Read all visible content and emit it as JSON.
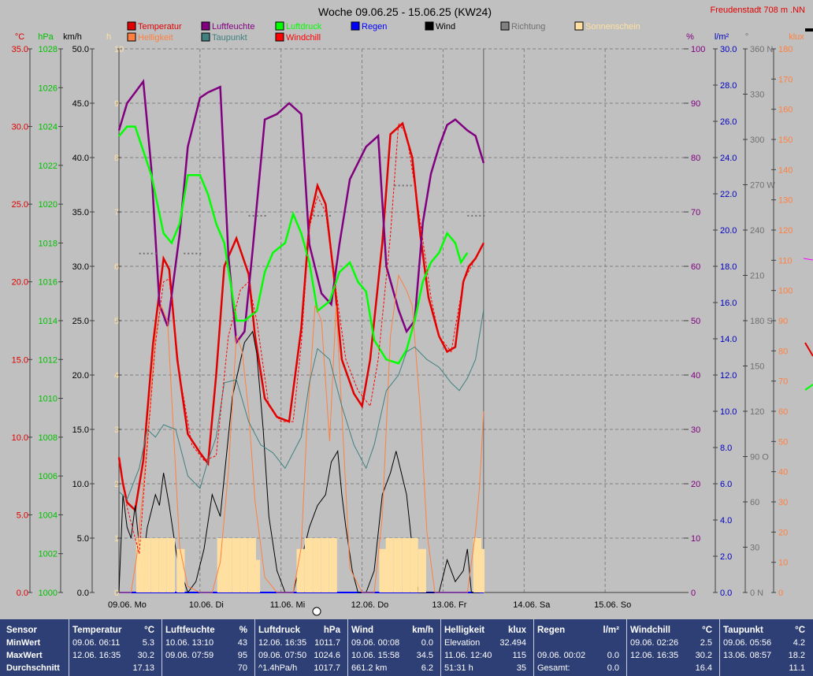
{
  "title": "Woche 09.06.25 - 15.06.25 (KW24)",
  "station": "Freudenstadt 708 m  .NN",
  "legend": [
    {
      "label": "Temperatur",
      "box": "#e00000",
      "text": "#e00000"
    },
    {
      "label": "Luftfeuchte",
      "box": "#800080",
      "text": "#800080"
    },
    {
      "label": "Luftdruck",
      "box": "#00ff00",
      "text": "#00ff00"
    },
    {
      "label": "Regen",
      "box": "#0000ff",
      "text": "#0000ff"
    },
    {
      "label": "Wind",
      "box": "#000000",
      "text": "#000000"
    },
    {
      "label": "Richtung",
      "box": "#808080",
      "text": "#707070"
    },
    {
      "label": "Sonnenschein",
      "box": "#ffe0a0",
      "text": "#ffe0a0"
    },
    {
      "label": "Helligkeit",
      "box": "#ff8040",
      "text": "#ff8040"
    },
    {
      "label": "Taupunkt",
      "box": "#408080",
      "text": "#408080"
    },
    {
      "label": "Windchill",
      "box": "#ff0000",
      "text": "#ff0000"
    }
  ],
  "axes": {
    "temp": {
      "unit": "°C",
      "color": "#e00000",
      "ticks": [
        "35.0",
        "30.0",
        "25.0",
        "20.0",
        "15.0",
        "10.0",
        "5.0",
        "0.0"
      ]
    },
    "pressure": {
      "unit": "hPa",
      "color": "#00c000",
      "ticks": [
        "1028",
        "1026",
        "1024",
        "1022",
        "1020",
        "1018",
        "1016",
        "1014",
        "1012",
        "1010",
        "1008",
        "1006",
        "1004",
        "1002",
        "1000"
      ]
    },
    "wind": {
      "unit": "km/h",
      "color": "#000000",
      "ticks": [
        "50.0",
        "45.0",
        "40.0",
        "35.0",
        "30.0",
        "25.0",
        "20.0",
        "15.0",
        "10.0",
        "5.0",
        "0.0"
      ]
    },
    "sun": {
      "unit": "h",
      "color": "#ffe0a0",
      "ticks": [
        "10",
        "9",
        "8",
        "7",
        "6",
        "5",
        "4",
        "3",
        "2",
        "1",
        "0"
      ]
    },
    "humidity": {
      "unit": "%",
      "color": "#800080",
      "ticks": [
        "100",
        "90",
        "80",
        "70",
        "60",
        "50",
        "40",
        "30",
        "20",
        "10",
        "0"
      ]
    },
    "rain": {
      "unit": "l/m²",
      "color": "#0000c0",
      "ticks": [
        "30.0",
        "28.0",
        "26.0",
        "24.0",
        "22.0",
        "20.0",
        "18.0",
        "16.0",
        "14.0",
        "12.0",
        "10.0",
        "8.0",
        "6.0",
        "4.0",
        "2.0",
        "0.0"
      ]
    },
    "direction": {
      "unit": "°",
      "color": "#707070",
      "ticks": [
        "360 N",
        "330",
        "300",
        "270 W",
        "240",
        "210",
        "180 S",
        "150",
        "120",
        "90 O",
        "60",
        "30",
        "0 N"
      ]
    },
    "lux": {
      "unit": "klux",
      "color": "#ff8040",
      "ticks": [
        "180",
        "170",
        "160",
        "150",
        "140",
        "130",
        "120",
        "110",
        "100",
        "90",
        "80",
        "70",
        "60",
        "50",
        "40",
        "30",
        "20",
        "10",
        "0"
      ]
    }
  },
  "x_labels": [
    "09.06. Mo",
    "10.06. Di",
    "11.06. Mi",
    "12.06. Do",
    "13.06. Fr",
    "14.06. Sa",
    "15.06. So"
  ],
  "chart_data": {
    "type": "line",
    "title": "Woche 09.06.25 - 15.06.25 (KW24)",
    "x_unit": "day",
    "x_range": [
      0,
      7
    ],
    "series": [
      {
        "name": "Temperatur",
        "axis": "temp",
        "color": "#e00000",
        "x": [
          0,
          0.05,
          0.1,
          0.2,
          0.3,
          0.42,
          0.55,
          0.62,
          0.72,
          0.85,
          1.0,
          1.1,
          1.2,
          1.3,
          1.45,
          1.6,
          1.68,
          1.8,
          1.95,
          2.1,
          2.25,
          2.35,
          2.45,
          2.55,
          2.65,
          2.75,
          2.9,
          3.0,
          3.1,
          3.25,
          3.35,
          3.5,
          3.62,
          3.72,
          3.82,
          3.95,
          4.05,
          4.15,
          4.25,
          4.32,
          4.4,
          4.5
        ],
        "y": [
          8.7,
          7.0,
          5.8,
          5.3,
          8.5,
          16.0,
          21.5,
          20.8,
          15.0,
          10.2,
          9.0,
          8.3,
          14.0,
          21.0,
          22.8,
          20.5,
          16.5,
          12.5,
          11.3,
          11.0,
          17.0,
          23.8,
          26.2,
          25.0,
          20.5,
          15.0,
          12.8,
          12.0,
          15.0,
          22.5,
          29.5,
          30.2,
          28.0,
          23.0,
          19.0,
          16.5,
          15.5,
          15.8,
          20.0,
          21.0,
          21.5,
          22.5
        ]
      },
      {
        "name": "Luftfeuchte",
        "axis": "humidity",
        "color": "#800080",
        "x": [
          0,
          0.1,
          0.2,
          0.3,
          0.4,
          0.5,
          0.6,
          0.75,
          0.85,
          1.0,
          1.1,
          1.25,
          1.35,
          1.45,
          1.55,
          1.65,
          1.8,
          1.95,
          2.1,
          2.25,
          2.35,
          2.5,
          2.62,
          2.72,
          2.85,
          2.95,
          3.05,
          3.2,
          3.3,
          3.45,
          3.55,
          3.65,
          3.75,
          3.85,
          3.95,
          4.05,
          4.15,
          4.3,
          4.4,
          4.5
        ],
        "y": [
          85,
          90,
          92,
          94,
          78,
          53,
          49,
          66,
          82,
          91,
          92,
          93,
          62,
          46,
          48,
          63,
          87,
          88,
          90,
          88,
          64,
          55,
          53,
          64,
          76,
          79,
          82,
          84,
          60,
          52,
          48,
          50,
          68,
          77,
          82,
          86,
          87,
          85,
          84,
          79
        ]
      },
      {
        "name": "Luftdruck",
        "axis": "pressure",
        "color": "#00ff00",
        "x": [
          0,
          0.1,
          0.2,
          0.28,
          0.4,
          0.55,
          0.65,
          0.75,
          0.85,
          1.0,
          1.1,
          1.2,
          1.3,
          1.45,
          1.55,
          1.7,
          1.8,
          1.9,
          2.05,
          2.15,
          2.25,
          2.35,
          2.45,
          2.6,
          2.72,
          2.85,
          2.95,
          3.05,
          3.15,
          3.3,
          3.45,
          3.55,
          3.65,
          3.75,
          3.85,
          3.95,
          4.05,
          4.15,
          4.22,
          4.3
        ],
        "y": [
          1023.5,
          1024.0,
          1024.0,
          1023.0,
          1021.5,
          1018.5,
          1018.0,
          1019.0,
          1021.5,
          1021.5,
          1020.5,
          1019.0,
          1018.0,
          1014.0,
          1014.0,
          1014.5,
          1016.5,
          1017.5,
          1018.0,
          1019.5,
          1018.5,
          1017.0,
          1014.5,
          1015.0,
          1016.5,
          1017.0,
          1016.0,
          1015.5,
          1013.0,
          1012.0,
          1011.8,
          1012.5,
          1014.0,
          1016.0,
          1017.0,
          1017.5,
          1018.5,
          1018.0,
          1017.0,
          1017.5
        ]
      },
      {
        "name": "Regen",
        "axis": "rain",
        "color": "#0000ff",
        "x": [
          0,
          4.5
        ],
        "y": [
          0.0,
          0.0
        ]
      },
      {
        "name": "Wind",
        "axis": "wind",
        "color": "#000000",
        "x": [
          0,
          0.05,
          0.1,
          0.15,
          0.2,
          0.28,
          0.35,
          0.45,
          0.5,
          0.55,
          0.62,
          0.72,
          0.85,
          0.95,
          1.05,
          1.15,
          1.25,
          1.4,
          1.55,
          1.65,
          1.7,
          1.78,
          1.85,
          1.95,
          2.05,
          2.15,
          2.25,
          2.35,
          2.45,
          2.55,
          2.62,
          2.7,
          2.75,
          2.8,
          2.88,
          2.95,
          3.05,
          3.15,
          3.25,
          3.35,
          3.42,
          3.55,
          3.65,
          3.7,
          3.85,
          3.95,
          4.05,
          4.15,
          4.25,
          4.3,
          4.35,
          4.4,
          4.45
        ],
        "y": [
          0,
          9,
          6,
          5,
          8,
          2,
          6,
          9,
          8,
          11,
          8,
          3,
          0,
          1,
          4,
          9,
          7,
          18,
          23,
          24,
          22,
          15,
          7,
          2,
          0,
          0,
          3,
          6,
          8,
          9,
          12,
          13,
          9,
          6,
          2,
          0,
          0,
          2,
          9,
          11,
          13,
          9,
          2,
          0,
          0,
          0,
          3,
          1,
          2,
          4,
          0,
          0,
          0
        ]
      },
      {
        "name": "Richtung",
        "axis": "direction",
        "color": "#707070",
        "x": [
          0.25,
          0.8,
          1.6,
          2.4,
          3.4,
          4.3
        ],
        "y": [
          225,
          225,
          250,
          250,
          270,
          250
        ]
      },
      {
        "name": "Sonnenschein",
        "axis": "sun",
        "color": "#ffe0a0",
        "x": [
          0.22,
          0.3,
          0.4,
          0.5,
          0.6,
          0.72,
          1.22,
          1.3,
          1.4,
          1.5,
          1.6,
          1.65,
          2.2,
          2.3,
          2.4,
          2.5,
          2.6,
          3.22,
          3.3,
          3.4,
          3.5,
          3.6,
          3.7,
          4.38,
          4.42
        ],
        "y": [
          1,
          1,
          1,
          1,
          1,
          0.8,
          1,
          1,
          1,
          1,
          1,
          0.6,
          0.8,
          1,
          1,
          1,
          1,
          0.8,
          1,
          1,
          1,
          1,
          0.8,
          1,
          0.8
        ]
      },
      {
        "name": "Helligkeit",
        "axis": "lux",
        "color": "#ff8040",
        "x": [
          0,
          0.15,
          0.22,
          0.3,
          0.38,
          0.45,
          0.52,
          0.6,
          0.68,
          0.75,
          0.85,
          1.0,
          1.15,
          1.25,
          1.35,
          1.45,
          1.52,
          1.6,
          1.68,
          1.8,
          1.95,
          2.15,
          2.25,
          2.32,
          2.42,
          2.5,
          2.6,
          2.68,
          2.75,
          2.85,
          3.0,
          3.15,
          3.25,
          3.35,
          3.45,
          3.55,
          3.62,
          3.72,
          3.8,
          3.9,
          4.1,
          4.3,
          4.4,
          4.45,
          4.5
        ],
        "y": [
          0,
          0,
          12,
          35,
          60,
          85,
          95,
          90,
          50,
          15,
          2,
          0,
          0,
          10,
          40,
          85,
          80,
          60,
          30,
          5,
          0,
          0,
          15,
          55,
          95,
          90,
          50,
          95,
          60,
          8,
          0,
          0,
          25,
          85,
          105,
          100,
          95,
          60,
          20,
          0,
          0,
          0,
          20,
          35,
          60
        ]
      },
      {
        "name": "Taupunkt",
        "axis": "temp",
        "color": "#408080",
        "x": [
          0,
          0.1,
          0.25,
          0.35,
          0.45,
          0.55,
          0.7,
          0.85,
          1.0,
          1.1,
          1.2,
          1.3,
          1.45,
          1.6,
          1.75,
          1.9,
          2.05,
          2.25,
          2.35,
          2.45,
          2.6,
          2.75,
          2.9,
          3.05,
          3.15,
          3.3,
          3.45,
          3.55,
          3.65,
          3.8,
          3.95,
          4.1,
          4.2,
          4.3,
          4.4,
          4.5
        ],
        "y": [
          6.5,
          6.0,
          8.0,
          10.5,
          10.0,
          10.8,
          10.5,
          7.5,
          6.7,
          8.5,
          10.0,
          13.5,
          13.7,
          11.0,
          9.5,
          9.0,
          8.0,
          10.0,
          13.5,
          15.7,
          15.0,
          12.0,
          9.5,
          8.0,
          9.5,
          13.0,
          14.0,
          15.5,
          15.8,
          15.0,
          14.5,
          13.5,
          13.0,
          13.8,
          15.0,
          18.2
        ]
      },
      {
        "name": "Windchill",
        "axis": "temp",
        "color": "#ff0000",
        "x": [
          0,
          0.1,
          0.25,
          0.35,
          0.45,
          0.55,
          0.62,
          0.75,
          0.9,
          1.05,
          1.2,
          1.35,
          1.5,
          1.6,
          1.7,
          1.85,
          2.0,
          2.15,
          2.25,
          2.35,
          2.45,
          2.55,
          2.65,
          2.8,
          2.95,
          3.1,
          3.2,
          3.35,
          3.45,
          3.55,
          3.7,
          3.85,
          3.95,
          4.1,
          4.25,
          4.35,
          4.45,
          4.5
        ],
        "y": [
          8.7,
          5.5,
          2.5,
          9.5,
          16.0,
          20.0,
          20.2,
          14.0,
          9.5,
          8.5,
          8.8,
          16.5,
          19.5,
          20.0,
          17.5,
          12.0,
          11.0,
          11.0,
          16.0,
          23.5,
          25.5,
          24.5,
          20.5,
          15.0,
          13.0,
          12.0,
          15.0,
          23.0,
          30.2,
          29.5,
          24.5,
          19.0,
          16.5,
          15.5,
          20.0,
          21.0,
          22.0,
          22.5
        ]
      }
    ],
    "grid": true
  },
  "stats": {
    "row_labels": [
      "Sensor",
      "MinWert",
      "MaxWert",
      "Durchschnitt"
    ],
    "columns": [
      {
        "name": "Temperatur",
        "unit": "°C",
        "rows": [
          [
            "09.06.  06:11",
            "5.3"
          ],
          [
            "12.06.  16:35",
            "30.2"
          ],
          [
            "",
            "17.13"
          ]
        ]
      },
      {
        "name": "Luftfeuchte",
        "unit": "%",
        "rows": [
          [
            "10.06.  13:10",
            "43"
          ],
          [
            "09.06.  07:59",
            "95"
          ],
          [
            "",
            "70"
          ]
        ]
      },
      {
        "name": "Luftdruck",
        "unit": "hPa",
        "rows": [
          [
            "12.06.  16:35",
            "1011.7"
          ],
          [
            "09.06.  07:50",
            "1024.6"
          ],
          [
            "^1.4hPa/h",
            "1017.7"
          ]
        ]
      },
      {
        "name": "Wind",
        "unit": "km/h",
        "rows": [
          [
            "09.06.  00:08",
            "0.0"
          ],
          [
            "10.06.  15:58",
            "34.5"
          ],
          [
            "661.2 km",
            "6.2"
          ]
        ]
      },
      {
        "name": "Helligkeit",
        "unit": "klux",
        "rows": [
          [
            "Elevation",
            "32.494"
          ],
          [
            "11.06.  12:40",
            "115"
          ],
          [
            "51:31 h",
            "35"
          ]
        ]
      },
      {
        "name": "Regen",
        "unit": "l/m²",
        "rows": [
          [
            "",
            ""
          ],
          [
            "09.06.  00:02",
            "0.0"
          ],
          [
            "Gesamt:",
            "0.0"
          ]
        ]
      },
      {
        "name": "Windchill",
        "unit": "°C",
        "rows": [
          [
            "09.06.  02:26",
            "2.5"
          ],
          [
            "12.06.  16:35",
            "30.2"
          ],
          [
            "",
            "16.4"
          ]
        ]
      },
      {
        "name": "Taupunkt",
        "unit": "°C",
        "rows": [
          [
            "09.06.  05:56",
            "4.2"
          ],
          [
            "13.06.  08:57",
            "18.2"
          ],
          [
            "",
            "11.1"
          ]
        ]
      }
    ]
  }
}
